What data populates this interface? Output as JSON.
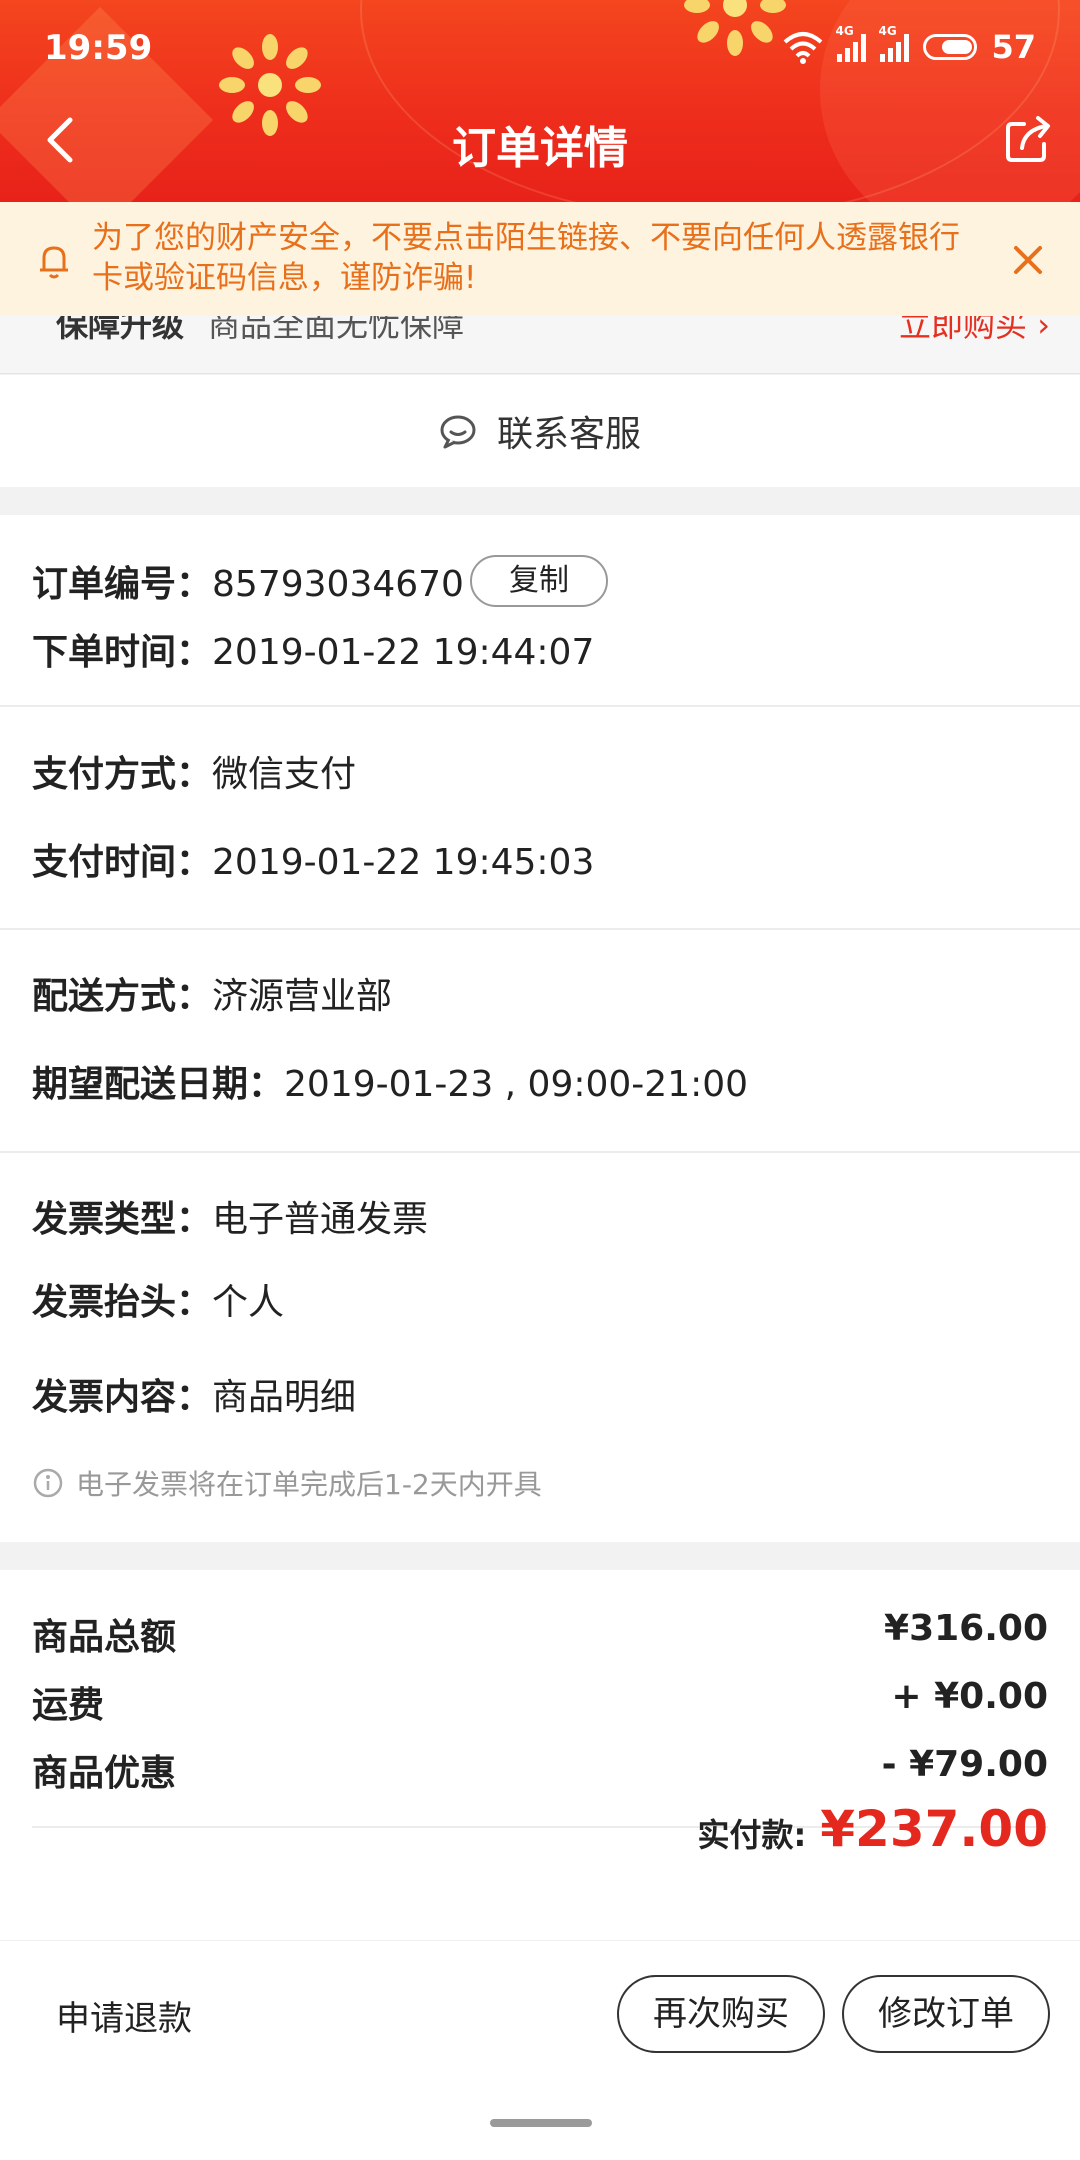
{
  "status_bar": {
    "time": "19:59",
    "net1": "4G",
    "net2": "4G",
    "battery": "57"
  },
  "nav": {
    "title": "订单详情"
  },
  "notice": {
    "text": "为了您的财产安全，不要点击陌生链接、不要向任何人透露银行卡或验证码信息，谨防诈骗!"
  },
  "peek": {
    "left": "保障升级",
    "middle": "商品全面无忧保障",
    "right": "立即购买 ›"
  },
  "service": {
    "label": "联系客服"
  },
  "order": {
    "number_label": "订单编号：",
    "number": "85793034670",
    "copy_label": "复制",
    "time_label": "下单时间：",
    "time": "2019-01-22 19:44:07"
  },
  "payment": {
    "method_label": "支付方式：",
    "method": "微信支付",
    "time_label": "支付时间：",
    "time": "2019-01-22 19:45:03"
  },
  "delivery": {
    "method_label": "配送方式：",
    "method": "济源营业部",
    "date_label": "期望配送日期：",
    "date": "2019-01-23 , 09:00-21:00"
  },
  "invoice": {
    "type_label": "发票类型：",
    "type": "电子普通发票",
    "header_label": "发票抬头：",
    "header": "个人",
    "content_label": "发票内容：",
    "content": "商品明细",
    "tip": "电子发票将在订单完成后1-2天内开具"
  },
  "prices": {
    "subtotal_label": "商品总额",
    "subtotal": "¥316.00",
    "shipping_label": "运费",
    "shipping": "+ ¥0.00",
    "discount_label": "商品优惠",
    "discount": "- ¥79.00",
    "total_label": "实付款:",
    "total": "¥237.00"
  },
  "footer": {
    "refund": "申请退款",
    "rebuy": "再次购买",
    "modify": "修改订单"
  },
  "colors": {
    "header_red": "#ee2e1c",
    "notice_bg": "#fdf3df",
    "notice_text": "#e8701b",
    "price_red": "#e5281e"
  }
}
